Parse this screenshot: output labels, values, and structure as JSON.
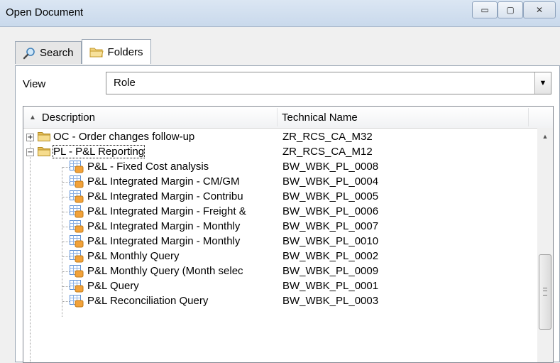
{
  "window": {
    "title": "Open Document",
    "minimize_glyph": "▭",
    "maximize_glyph": "▢",
    "close_glyph": "✕"
  },
  "tabs": [
    {
      "label": "Search",
      "icon": "search-icon"
    },
    {
      "label": "Folders",
      "icon": "folder-icon",
      "active": true
    }
  ],
  "view": {
    "label": "View",
    "selected": "Role",
    "arrow": "▼"
  },
  "tree": {
    "columns": {
      "sort_arrow": "▲",
      "description": "Description",
      "technical_name": "Technical Name"
    },
    "rows": [
      {
        "type": "folder",
        "expanded": false,
        "description": "OC - Order changes follow-up",
        "technical": "ZR_RCS_CA_M32"
      },
      {
        "type": "folder",
        "expanded": true,
        "description": "PL - P&L Reporting",
        "technical": "ZR_RCS_CA_M12"
      },
      {
        "type": "query",
        "description": "P&L - Fixed Cost analysis",
        "technical": "BW_WBK_PL_0008"
      },
      {
        "type": "query",
        "description": "P&L Integrated Margin - CM/GM",
        "technical": "BW_WBK_PL_0004"
      },
      {
        "type": "query",
        "description": "P&L Integrated Margin - Contribu",
        "technical": "BW_WBK_PL_0005"
      },
      {
        "type": "query",
        "description": "P&L Integrated Margin - Freight &",
        "technical": "BW_WBK_PL_0006"
      },
      {
        "type": "query",
        "description": "P&L Integrated Margin - Monthly",
        "technical": "BW_WBK_PL_0007"
      },
      {
        "type": "query",
        "description": "P&L Integrated Margin - Monthly",
        "technical": "BW_WBK_PL_0010"
      },
      {
        "type": "query",
        "description": "P&L Monthly Query",
        "technical": "BW_WBK_PL_0002"
      },
      {
        "type": "query",
        "description": "P&L Monthly Query (Month selec",
        "technical": "BW_WBK_PL_0009"
      },
      {
        "type": "query",
        "description": "P&L Query",
        "technical": "BW_WBK_PL_0001"
      },
      {
        "type": "query",
        "description": "P&L Reconciliation Query",
        "technical": "BW_WBK_PL_0003"
      }
    ],
    "expander_collapsed": "+",
    "expander_expanded": "−"
  },
  "scrollbar": {
    "up": "▲",
    "down": "▼"
  },
  "colors": {
    "folder_yellow": "#e8c05a",
    "query_blue": "#5a8fd6",
    "query_orange": "#f2a23a"
  }
}
